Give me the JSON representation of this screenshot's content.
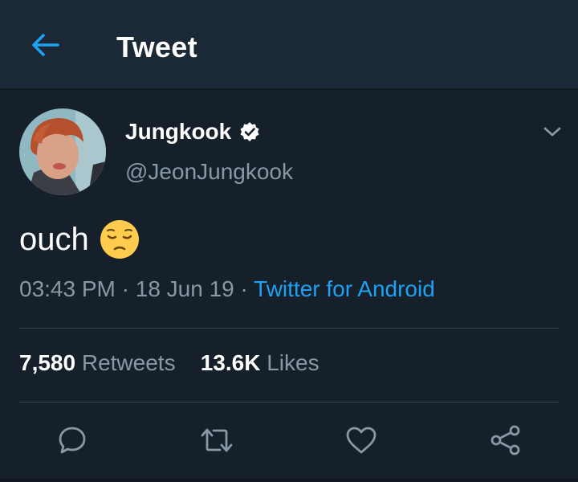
{
  "header": {
    "title": "Tweet",
    "back_icon": "arrow-left-icon"
  },
  "tweet": {
    "author": {
      "name": "Jungkook",
      "handle": "@JeonJungkook",
      "verified": true
    },
    "text": "ouch",
    "emoji": "pensive-face",
    "time": "03:43 PM",
    "date": "18 Jun 19",
    "separator": " · ",
    "source": "Twitter for Android",
    "retweets_count": "7,580",
    "retweets_label": "Retweets",
    "likes_count": "13.6K",
    "likes_label": "Likes"
  },
  "actions": [
    "reply-icon",
    "retweet-icon",
    "like-icon",
    "share-icon"
  ],
  "colors": {
    "background": "#15202b",
    "header": "#1b2836",
    "accent": "#1da1f2",
    "secondary_text": "#8899a6",
    "divider": "#38444d"
  }
}
